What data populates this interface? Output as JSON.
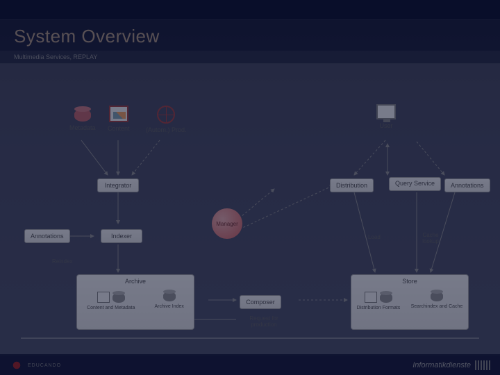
{
  "header": {
    "title": "System Overview",
    "subtitle": "Multimedia Services, REPLAY"
  },
  "nodes": {
    "metadata": "Metadata",
    "content": "Content",
    "autom_prod": "(Autom.) Prod.",
    "user": "User",
    "integrator": "Integrator",
    "distribution": "Distribution",
    "query_service": "Query Service",
    "annotations_right": "Annotations",
    "manager": "Manager",
    "annotations_left": "Annotations",
    "indexer": "Indexer",
    "load": "Load",
    "cache_lookup": "Cache lookup",
    "reindex": "Reindex",
    "archive": "Archive",
    "store": "Store",
    "composer": "Composer",
    "content_metadata": "Content and Metadata",
    "archive_index": "Archive Index",
    "request_prod": "Request for production",
    "dist_formats": "Distribution Formats",
    "search_cache": "Searchindex and Cache"
  },
  "footer": {
    "left_brand": "EDUCANDO",
    "right_brand": "Informatikdienste"
  }
}
